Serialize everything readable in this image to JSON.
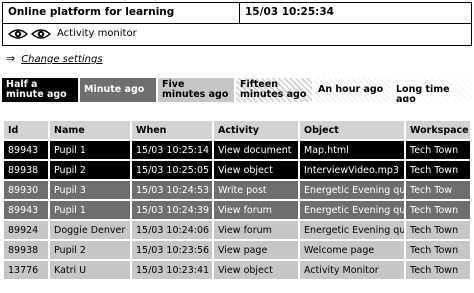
{
  "header": {
    "title": "Online platform for learning",
    "time": "15/03 10:25:34",
    "monitor_label": "Activity monitor"
  },
  "icons": {
    "eye": "eye-icon",
    "arrow": "right-arrow-icon"
  },
  "change_settings": "Change settings",
  "legend": [
    {
      "label": "Half a minute ago"
    },
    {
      "label": "Minute ago"
    },
    {
      "label": "Five minutes ago"
    },
    {
      "label": "Fifteen minutes ago"
    },
    {
      "label": "An hour ago"
    },
    {
      "label": "Long time ago"
    }
  ],
  "colors": {
    "half_minute": "#000000",
    "minute": "#6e6e6e",
    "five_minutes": "#c6c6c6",
    "header_cell": "#d2d2d2"
  },
  "table": {
    "columns": [
      "Id",
      "Name",
      "When",
      "Activity",
      "Object",
      "Workspace"
    ],
    "rows": [
      {
        "age": 0,
        "cells": [
          "89943",
          "Pupil 1",
          "15/03 10:25:14",
          "View document",
          "Map.html",
          "Tech Town"
        ]
      },
      {
        "age": 0,
        "cells": [
          "89938",
          "Pupil 2",
          "15/03 10:25:05",
          "View object",
          "InterviewVideo.mp3",
          "Tech Town"
        ]
      },
      {
        "age": 1,
        "cells": [
          "89930",
          "Pupil 3",
          "15/03 10:24:53",
          "Write post",
          "Energetic Evening quiz",
          "Tech Tow"
        ]
      },
      {
        "age": 1,
        "cells": [
          "89943",
          "Pupil 1",
          "15/03 10:24:39",
          "View forum",
          "Energetic Evening quiz",
          "Tech Town"
        ]
      },
      {
        "age": 2,
        "cells": [
          "89924",
          "Doggie Denver",
          "15/03 10:24:06",
          "View forum",
          "Energetic Evening quiz",
          "Tech Town"
        ]
      },
      {
        "age": 2,
        "cells": [
          "89938",
          "Pupil 2",
          "15/03 10:23:56",
          "View page",
          "Welcome page",
          "Tech Town"
        ]
      },
      {
        "age": 2,
        "cells": [
          "13776",
          "Katri U",
          "15/03 10:23:41",
          "View object",
          "Activity Monitor",
          "Tech Town"
        ]
      }
    ]
  }
}
